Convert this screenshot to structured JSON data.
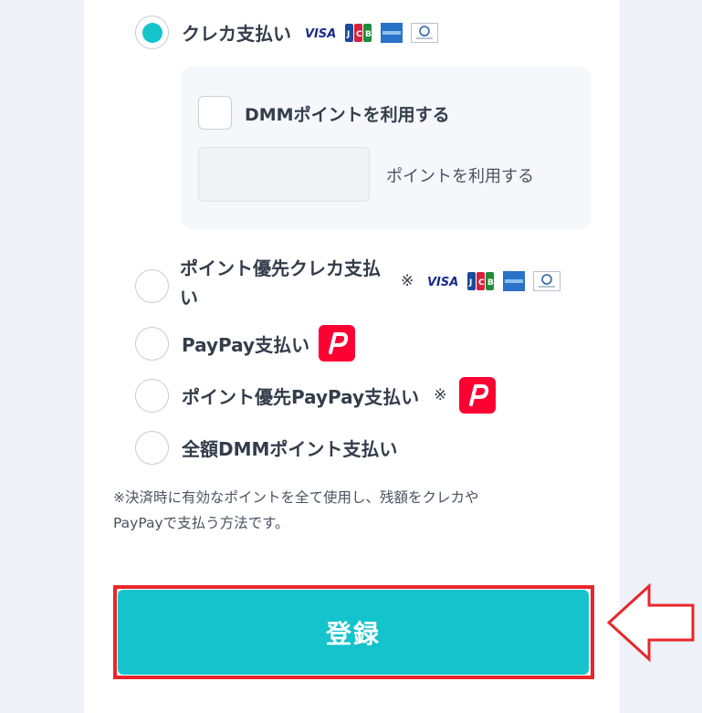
{
  "payment_options": [
    {
      "label": "クレカ支払い",
      "selected": true
    },
    {
      "label_line1": "ポイント優先クレカ支払",
      "label_line2": "い",
      "note_mark": "※"
    },
    {
      "label": "PayPay支払い"
    },
    {
      "label": "ポイント優先PayPay支払い",
      "note_mark": "※"
    },
    {
      "label": "全額DMMポイント支払い"
    }
  ],
  "points": {
    "checkbox_label": "DMMポイントを利用する",
    "input_value": "",
    "suffix": "ポイントを利用する"
  },
  "card_brands": [
    "visa-icon",
    "jcb-icon",
    "amex-icon",
    "diners-icon"
  ],
  "note": {
    "line1": "※決済時に有効なポイントを全て使用し、残額をクレカや",
    "line2": "PayPayで支払う方法です。"
  },
  "register_button": {
    "label": "登録"
  },
  "colors": {
    "accent": "#15c3cc",
    "highlight": "#e8262b",
    "paypay": "#ff0033",
    "background": "#eef1f8"
  }
}
